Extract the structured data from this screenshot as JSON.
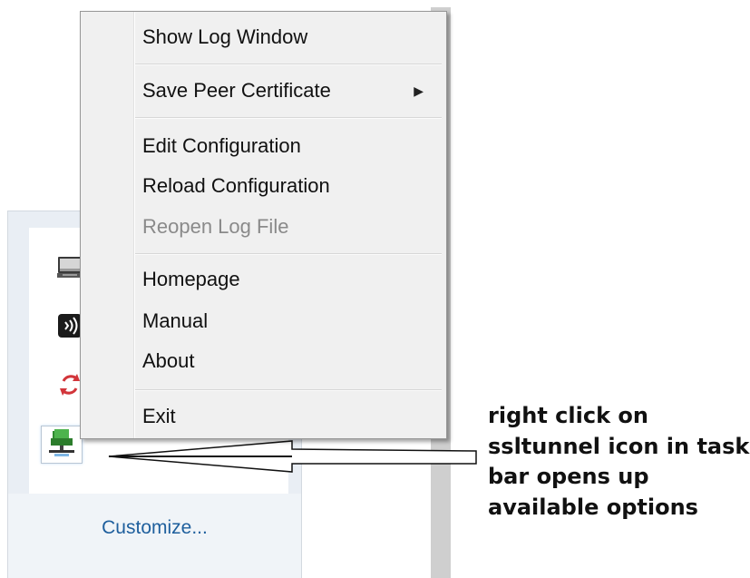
{
  "context_menu": {
    "items": {
      "show_log_window": "Show Log Window",
      "save_peer_certificate": "Save Peer Certificate",
      "edit_configuration": "Edit Configuration",
      "reload_configuration": "Reload Configuration",
      "reopen_log_file": "Reopen Log File",
      "homepage": "Homepage",
      "manual": "Manual",
      "about": "About",
      "exit": "Exit"
    },
    "disabled_items": [
      "Reopen Log File"
    ],
    "submenu_items": [
      "Save Peer Certificate"
    ]
  },
  "tray": {
    "customize_label": "Customize...",
    "icons": [
      "monitor-icon",
      "audio-icon",
      "sync-icon",
      "ssltunnel-icon"
    ]
  },
  "annotation": {
    "lines": [
      "right click on",
      "ssltunnel icon in task",
      "bar opens up",
      "available options"
    ]
  },
  "colors": {
    "menu_background": "#f0f0f0",
    "disabled_text": "#8a8a8a",
    "link_blue": "#1e5f9d",
    "tray_background": "#e9eef4"
  }
}
